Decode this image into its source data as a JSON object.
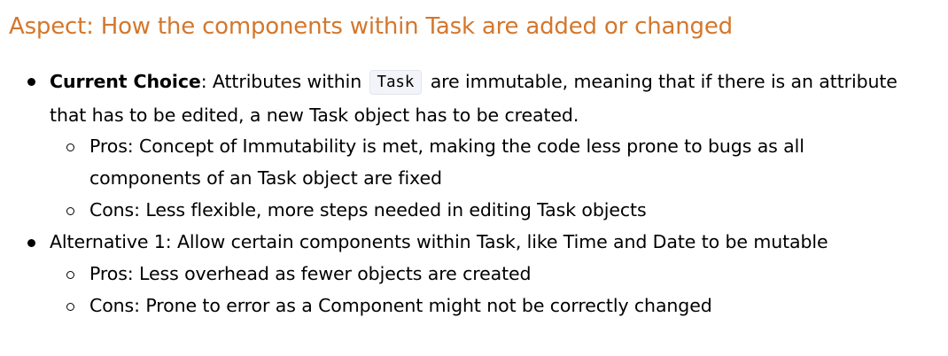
{
  "heading": "Aspect: How the components within Task are added or changed",
  "items": [
    {
      "lead_bold": "Current Choice",
      "lead_rest": ": Attributes within ",
      "code": "Task",
      "after_code": " are immutable, meaning that if there is an attribute",
      "line2": "that has to be edited, a new Task object has to be created.",
      "subitems": [
        {
          "line1": "Pros: Concept of Immutability is met, making the code less prone to bugs as all",
          "line2": "components of an Task object are fixed"
        },
        {
          "line1": "Cons: Less flexible, more steps needed in editing Task objects"
        }
      ]
    },
    {
      "line1": "Alternative 1: Allow certain components within Task, like Time and Date to be mutable",
      "subitems": [
        {
          "line1": "Pros: Less overhead as fewer objects are created"
        },
        {
          "line1": "Cons: Prone to error as a Component might not be correctly changed"
        }
      ]
    }
  ]
}
